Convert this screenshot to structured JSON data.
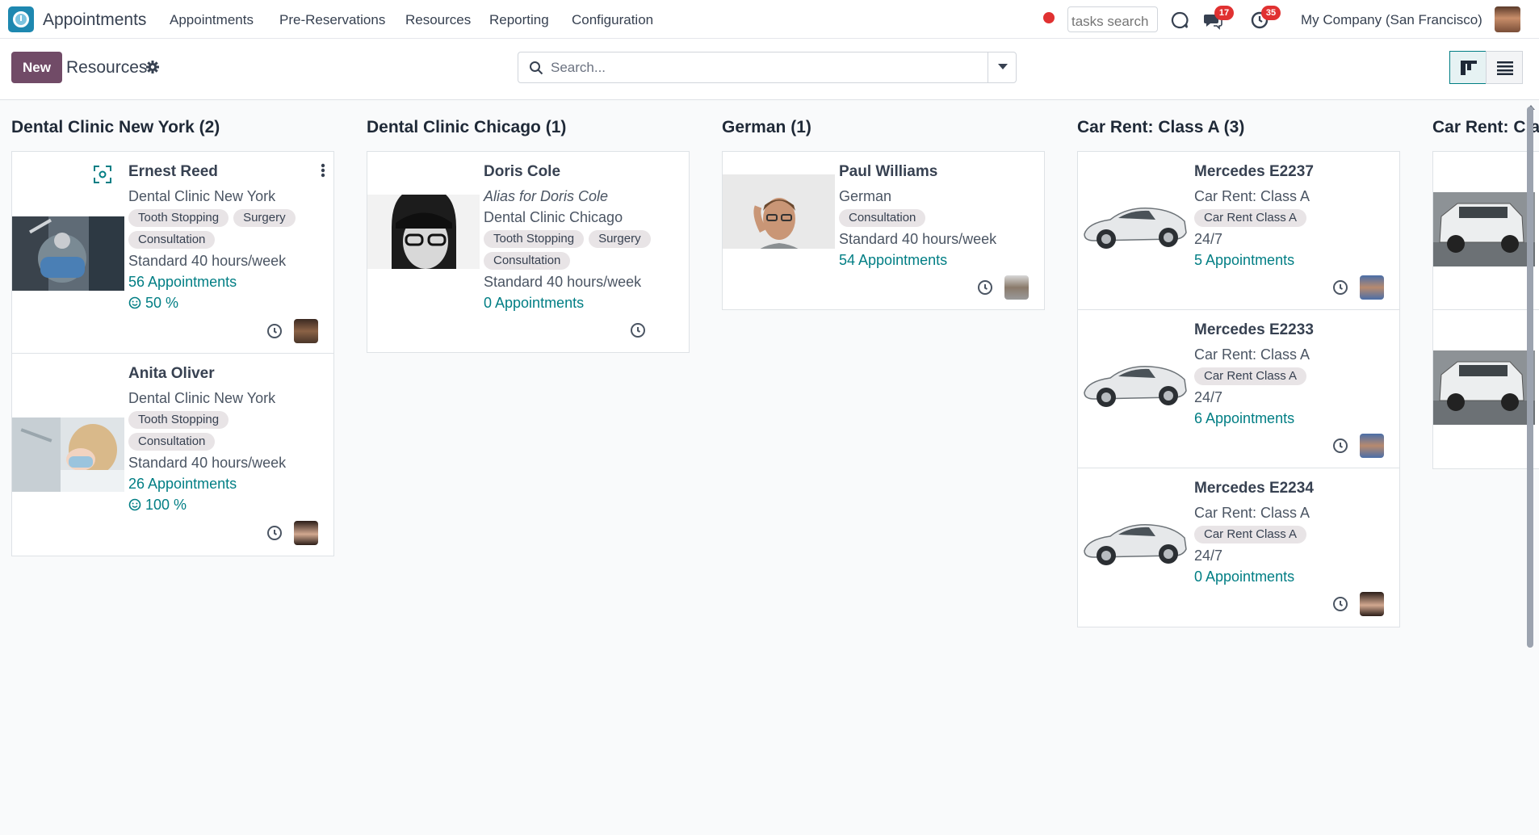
{
  "app": {
    "name": "Appointments",
    "logo_icon": "appointments-clock-icon"
  },
  "menu": [
    {
      "label": "Appointments"
    },
    {
      "label": "Pre-Reservations"
    },
    {
      "label": "Resources"
    },
    {
      "label": "Reporting"
    },
    {
      "label": "Configuration"
    }
  ],
  "systray": {
    "tasks_search_placeholder": "tasks search",
    "messages_count": "17",
    "activities_count": "35",
    "company": "My Company (San Francisco)"
  },
  "control": {
    "new_label": "New",
    "title": "Resources",
    "search_placeholder": "Search..."
  },
  "colors": {
    "brand": "#714b67",
    "link": "#017e84",
    "badge": "#e03131"
  },
  "columns": [
    {
      "title": "Dental Clinic New York (2)",
      "cards": [
        {
          "name": "Ernest Reed",
          "location": "Dental Clinic New York",
          "tags": [
            "Tooth Stopping",
            "Surgery",
            "Consultation"
          ],
          "hours": "Standard 40 hours/week",
          "appointments": "56 Appointments",
          "rating": "50 %"
        },
        {
          "name": "Anita Oliver",
          "location": "Dental Clinic New York",
          "tags": [
            "Tooth Stopping",
            "Consultation"
          ],
          "hours": "Standard 40 hours/week",
          "appointments": "26 Appointments",
          "rating": "100 %"
        }
      ]
    },
    {
      "title": "Dental Clinic Chicago (1)",
      "cards": [
        {
          "name": "Doris Cole",
          "alias": "Alias for Doris Cole",
          "location": "Dental Clinic Chicago",
          "tags": [
            "Tooth Stopping",
            "Surgery",
            "Consultation"
          ],
          "hours": "Standard 40 hours/week",
          "appointments": "0 Appointments"
        }
      ]
    },
    {
      "title": "German (1)",
      "cards": [
        {
          "name": "Paul Williams",
          "location": "German",
          "tags": [
            "Consultation"
          ],
          "hours": "Standard 40 hours/week",
          "appointments": "54 Appointments"
        }
      ]
    },
    {
      "title": "Car Rent: Class A (3)",
      "cards": [
        {
          "name": "Mercedes E2237",
          "location": "Car Rent: Class A",
          "tags": [
            "Car Rent Class A"
          ],
          "hours": "24/7",
          "appointments": "5 Appointments"
        },
        {
          "name": "Mercedes E2233",
          "location": "Car Rent: Class A",
          "tags": [
            "Car Rent Class A"
          ],
          "hours": "24/7",
          "appointments": "6 Appointments"
        },
        {
          "name": "Mercedes E2234",
          "location": "Car Rent: Class A",
          "tags": [
            "Car Rent Class A"
          ],
          "hours": "24/7",
          "appointments": "0 Appointments"
        }
      ]
    },
    {
      "title": "Car Rent: Cla",
      "cards": []
    }
  ]
}
